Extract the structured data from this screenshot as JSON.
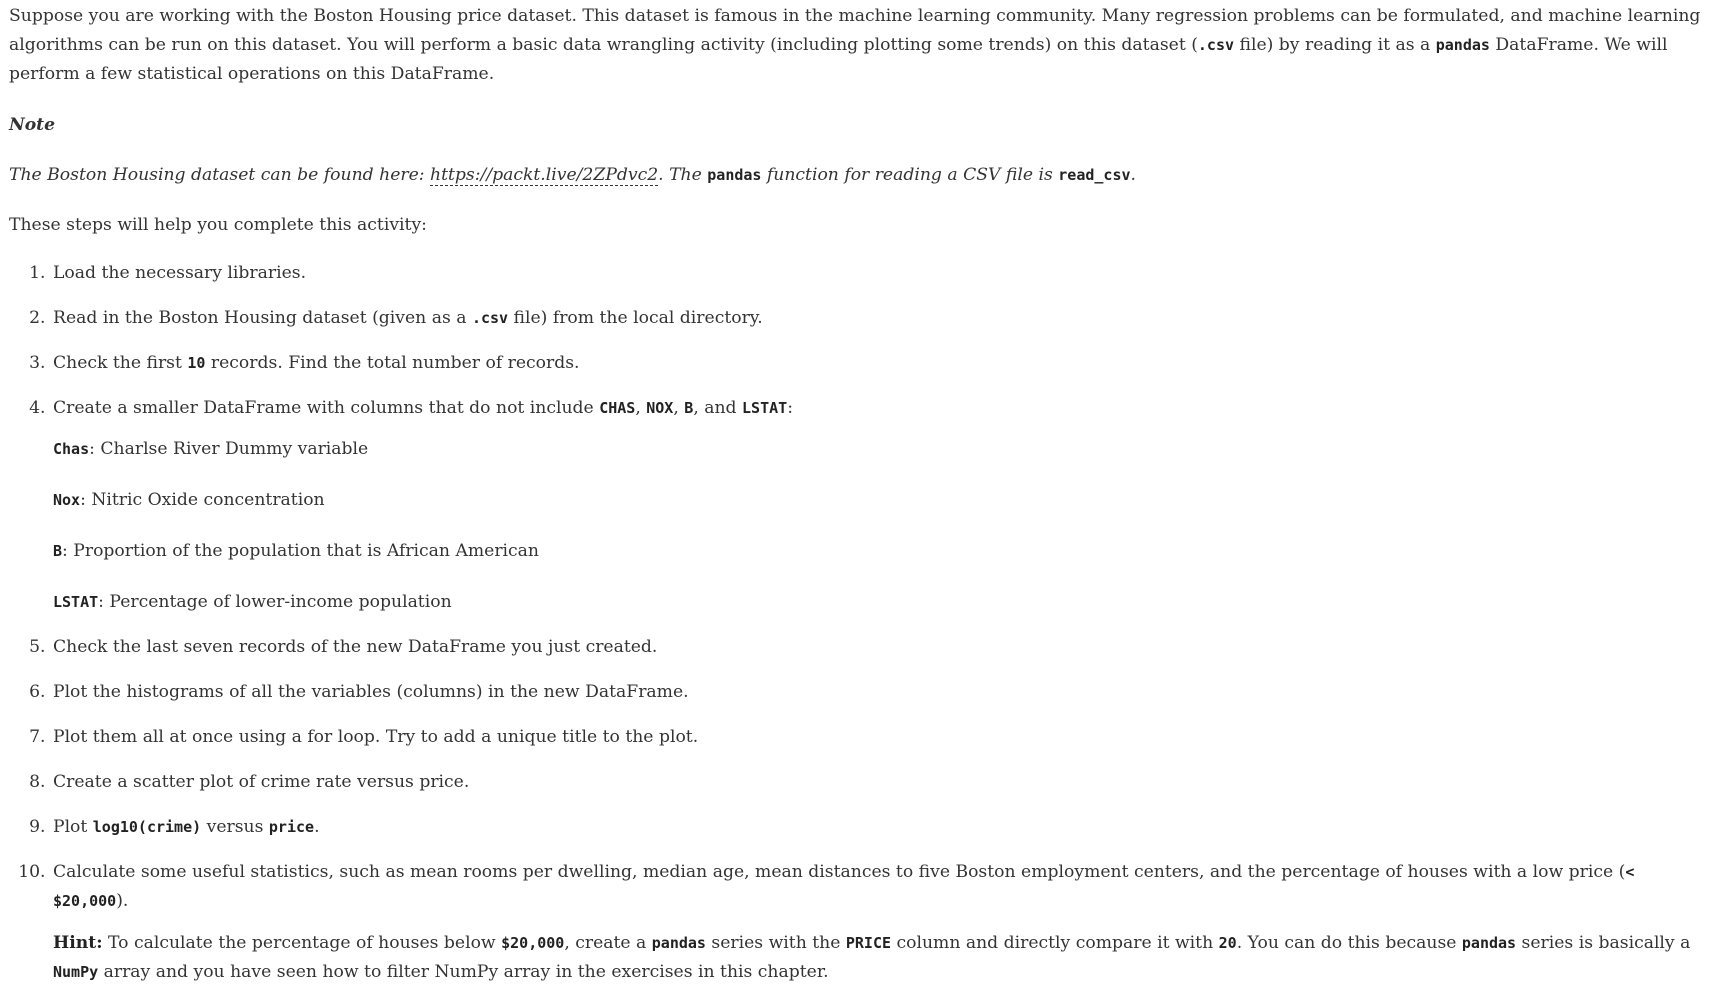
{
  "intro": {
    "p1_part1": "Suppose you are working with the Boston Housing price dataset. This dataset is famous in the machine learning community. Many regression problems can be formulated, and machine learning algorithms can be run on this dataset. You will perform a basic data wrangling activity (including plotting some trends) on this dataset (",
    "p1_code1": ".csv",
    "p1_part2": " file) by reading it as a ",
    "p1_code2": "pandas",
    "p1_part3": " DataFrame. We will perform a few statistical operations on this DataFrame."
  },
  "note": {
    "label": "Note",
    "text1": "The Boston Housing dataset can be found here: ",
    "link": "https://packt.live/2ZPdvc2",
    "text2": ". The ",
    "code1": "pandas",
    "text3": " function for reading a CSV file is ",
    "code2": "read_csv",
    "text4": "."
  },
  "steps_intro": "These steps will help you complete this activity:",
  "steps": {
    "s1": "Load the necessary libraries.",
    "s2_a": "Read in the Boston Housing dataset (given as a ",
    "s2_code": ".csv",
    "s2_b": " file) from the local directory.",
    "s3_a": "Check the first ",
    "s3_code": "10",
    "s3_b": " records. Find the total number of records.",
    "s4_a": "Create a smaller DataFrame with columns that do not include ",
    "s4_c1": "CHAS",
    "s4_sep1": ", ",
    "s4_c2": "NOX",
    "s4_sep2": ", ",
    "s4_c3": "B",
    "s4_sep3": ", and ",
    "s4_c4": "LSTAT",
    "s4_end": ":",
    "defs": [
      {
        "code": "Chas",
        "text": ": Charlse River Dummy variable"
      },
      {
        "code": "Nox",
        "text": ": Nitric Oxide concentration"
      },
      {
        "code": "B",
        "text": ": Proportion of the population that is African American"
      },
      {
        "code": "LSTAT",
        "text": ": Percentage of lower-income population"
      }
    ],
    "s5": "Check the last seven records of the new DataFrame you just created.",
    "s6": "Plot the histograms of all the variables (columns) in the new DataFrame.",
    "s7": "Plot them all at once using a for loop. Try to add a unique title to the plot.",
    "s8": "Create a scatter plot of crime rate versus price.",
    "s9_a": "Plot ",
    "s9_c1": "log10(crime)",
    "s9_b": " versus ",
    "s9_c2": "price",
    "s9_end": ".",
    "s10_a": "Calculate some useful statistics, such as mean rooms per dwelling, median age, mean distances to five Boston employment centers, and the percentage of houses with a low price (",
    "s10_code": "< $20,000",
    "s10_end": ")."
  },
  "hint": {
    "label": "Hint:",
    "t1": " To calculate the percentage of houses below ",
    "c1": "$20,000",
    "t2": ", create a ",
    "c2": "pandas",
    "t3": " series with the ",
    "c3": "PRICE",
    "t4": " column and directly compare it with ",
    "c4": "20",
    "t5": ". You can do this because ",
    "c5": "pandas",
    "t6": " series is basically a ",
    "c6": "NumPy",
    "t7": " array and you have seen how to filter NumPy array in the exercises in this chapter."
  }
}
